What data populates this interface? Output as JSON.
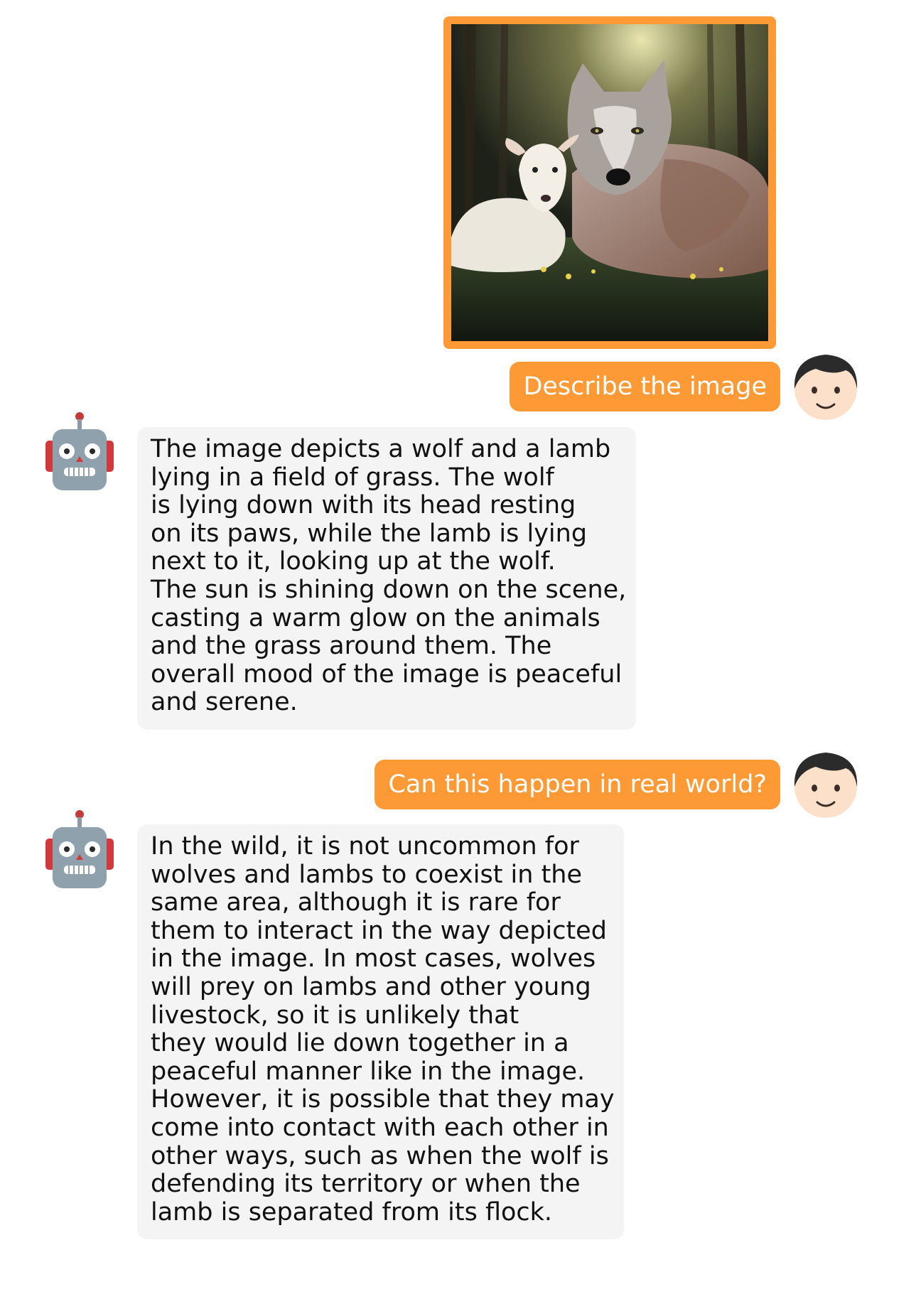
{
  "messages": [
    {
      "role": "user",
      "kind": "image",
      "image_alt": "wolf-and-lamb-in-forest"
    },
    {
      "role": "user",
      "kind": "text",
      "text": "Describe the image"
    },
    {
      "role": "assistant",
      "kind": "text",
      "text": "The image depicts a wolf and a lamb\nlying in a field of grass. The wolf\nis lying down with its head resting\non its paws, while the lamb is lying\nnext to it, looking up at the wolf.\nThe sun is shining down on the scene,\ncasting a warm glow on the animals\nand the grass around them. The\noverall mood of the image is peaceful\nand serene."
    },
    {
      "role": "user",
      "kind": "text",
      "text": "Can this happen in real world?"
    },
    {
      "role": "assistant",
      "kind": "text",
      "text": "In the wild, it is not uncommon for\nwolves and lambs to coexist in the\nsame area, although it is rare for\nthem to interact in the way depicted\nin the image. In most cases, wolves\nwill prey on lambs and other young\nlivestock, so it is unlikely that\nthey would lie down together in a\npeaceful manner like in the image.\nHowever, it is possible that they may\ncome into contact with each other in\nother ways, such as when the wolf is\ndefending its territory or when the\nlamb is separated from its flock."
    }
  ],
  "icons": {
    "user_avatar": "boy-face-icon",
    "assistant_avatar": "robot-face-icon"
  },
  "colors": {
    "user_bubble": "#fd9a36",
    "assistant_bubble": "#f4f4f4",
    "user_text": "#ffffff",
    "assistant_text": "#111111"
  }
}
